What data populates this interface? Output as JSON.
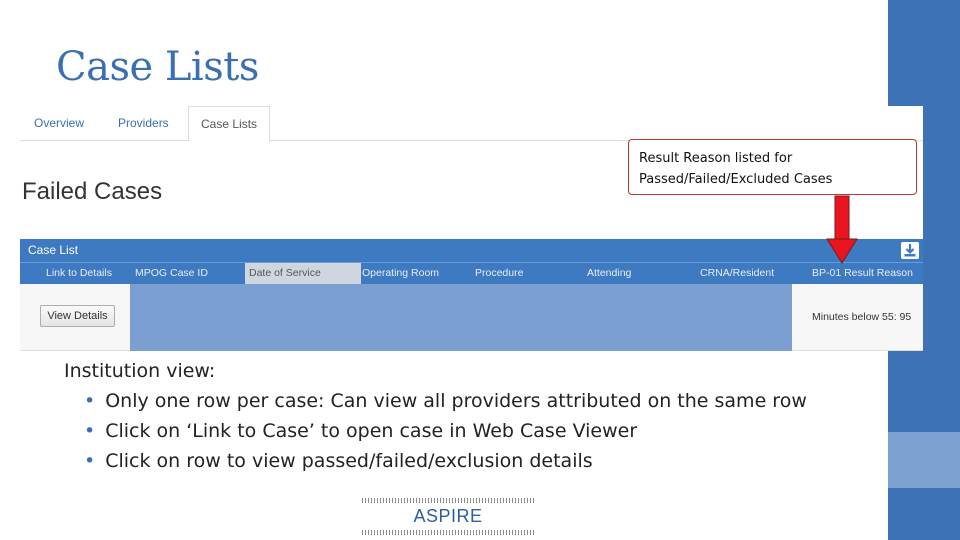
{
  "slide": {
    "title": "Case Lists"
  },
  "tabs": [
    {
      "label": "Overview"
    },
    {
      "label": "Providers"
    },
    {
      "label": "Case Lists"
    }
  ],
  "page": {
    "heading": "Failed Cases"
  },
  "callout": {
    "line1": "Result Reason listed for",
    "line2": "Passed/Failed/Excluded Cases"
  },
  "grid": {
    "title": "Case List",
    "columns": [
      "Link to Details",
      "MPOG Case ID",
      "Date of Service",
      "Operating Room",
      "Procedure",
      "Attending",
      "CRNA/Resident",
      "BP-01 Result Reason"
    ],
    "row": {
      "button_label": "View Details",
      "result_reason": "Minutes below 55: 95"
    }
  },
  "notes": {
    "intro": "Institution view:",
    "items": [
      "Only one row per case: Can view all providers attributed on the same row",
      "Click on ‘Link to Case’ to open case in Web Case Viewer",
      "Click on row to view passed/failed/exclusion details"
    ]
  },
  "logo": {
    "text": "ASPIRE"
  },
  "colors": {
    "accent": "#3b6fb3",
    "grid_header": "#3d7ac1",
    "callout_border": "#c0392b",
    "arrow": "#e8141e"
  }
}
